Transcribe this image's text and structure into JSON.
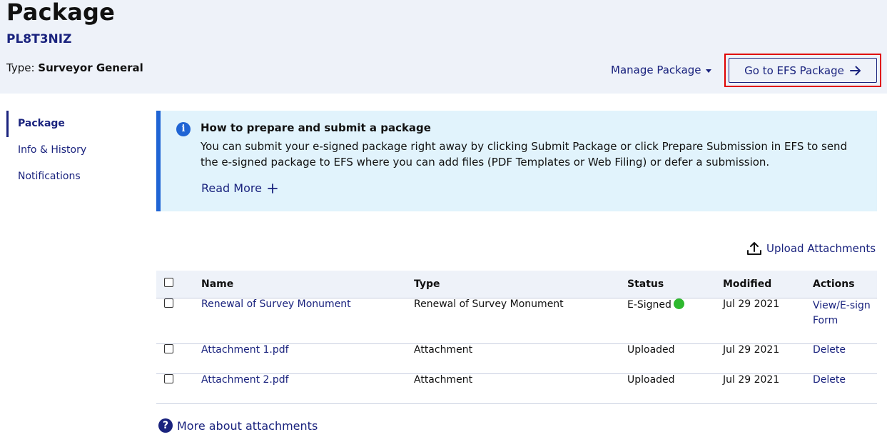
{
  "header": {
    "title": "Package",
    "package_id": "PL8T3NIZ",
    "type_label": "Type: ",
    "type_value": "Surveyor General",
    "manage_label": "Manage Package",
    "go_label": "Go to EFS Package"
  },
  "sidenav": {
    "items": [
      {
        "label": "Package"
      },
      {
        "label": "Info & History"
      },
      {
        "label": "Notifications"
      }
    ]
  },
  "info": {
    "title": "How to prepare and submit a package",
    "body": "You can submit your e-signed package right away by clicking Submit Package or click Prepare Submission in EFS to send the e-signed package to EFS where you can add files (PDF Templates or Web Filing) or defer a submission.",
    "read_more": "Read More",
    "icon": "info-icon"
  },
  "upload": {
    "label": "Upload Attachments",
    "icon": "upload-icon"
  },
  "table": {
    "columns": [
      "Name",
      "Type",
      "Status",
      "Modified",
      "Actions"
    ],
    "rows": [
      {
        "name": "Renewal of Survey Monument",
        "type": "Renewal of Survey Monument",
        "status": "E-Signed",
        "modified": "Jul 29 2021",
        "action": "View/E-sign Form"
      },
      {
        "name": "Attachment 1.pdf",
        "type": "Attachment",
        "status": "Uploaded",
        "modified": "Jul 29 2021",
        "action": "Delete"
      },
      {
        "name": "Attachment 2.pdf",
        "type": "Attachment",
        "status": "Uploaded",
        "modified": "Jul 29 2021",
        "action": "Delete"
      }
    ]
  },
  "footer": {
    "more_about": "More about attachments"
  },
  "colors": {
    "accent": "#1a237e",
    "header_bg": "#eef2f9",
    "info_bg": "#e1f3fc",
    "info_border": "#1f64d4",
    "highlight": "#e00000",
    "status_green": "#2eb82e"
  }
}
